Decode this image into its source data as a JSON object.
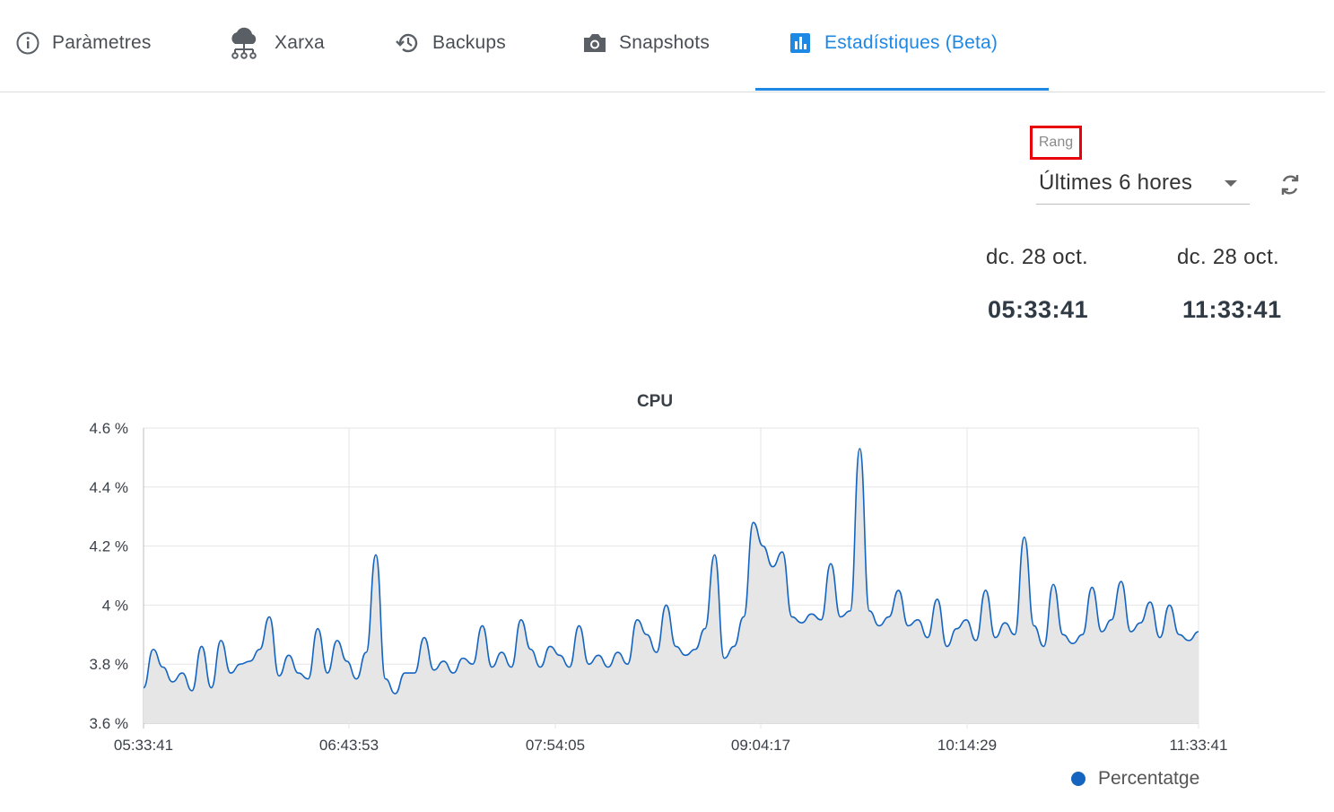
{
  "tabs": [
    {
      "label": "Paràmetres",
      "icon": "info-icon"
    },
    {
      "label": "Xarxa",
      "icon": "network-cloud-icon"
    },
    {
      "label": "Backups",
      "icon": "history-icon"
    },
    {
      "label": "Snapshots",
      "icon": "camera-icon"
    },
    {
      "label": "Estadístiques (Beta)",
      "icon": "bar-chart-icon",
      "active": true
    }
  ],
  "range": {
    "label": "Rang",
    "selected": "Últimes 6 hores",
    "refresh_icon": "refresh-icon"
  },
  "period": {
    "start_date": "dc. 28 oct.",
    "start_time": "05:33:41",
    "end_date": "dc. 28 oct.",
    "end_time": "11:33:41"
  },
  "colors": {
    "accent": "#1e88e5",
    "series": "#1565c0",
    "fill": "#e6e6e6",
    "highlight": "#e8000b"
  },
  "chart_data": {
    "type": "area",
    "title": "CPU",
    "xlabel": "",
    "ylabel": "",
    "x_ticks": [
      "05:33:41",
      "06:43:53",
      "07:54:05",
      "09:04:17",
      "10:14:29",
      "11:33:41"
    ],
    "y_ticks": [
      "3.6 %",
      "3.8 %",
      "4 %",
      "4.2 %",
      "4.4 %",
      "4.6 %"
    ],
    "ylim": [
      3.6,
      4.6
    ],
    "grid": true,
    "legend": "bottom-right",
    "series": [
      {
        "name": "Percentatge",
        "values": [
          3.72,
          3.85,
          3.79,
          3.74,
          3.77,
          3.71,
          3.86,
          3.72,
          3.88,
          3.77,
          3.8,
          3.81,
          3.85,
          3.96,
          3.76,
          3.83,
          3.77,
          3.75,
          3.92,
          3.77,
          3.88,
          3.81,
          3.75,
          3.84,
          4.17,
          3.75,
          3.7,
          3.77,
          3.77,
          3.89,
          3.78,
          3.81,
          3.77,
          3.82,
          3.8,
          3.93,
          3.79,
          3.84,
          3.79,
          3.95,
          3.85,
          3.79,
          3.86,
          3.83,
          3.79,
          3.93,
          3.8,
          3.83,
          3.79,
          3.84,
          3.8,
          3.95,
          3.9,
          3.84,
          4.0,
          3.86,
          3.83,
          3.85,
          3.92,
          4.17,
          3.82,
          3.86,
          3.96,
          4.28,
          4.2,
          4.13,
          4.18,
          3.96,
          3.94,
          3.97,
          3.95,
          4.14,
          3.96,
          3.98,
          4.53,
          3.98,
          3.93,
          3.96,
          4.05,
          3.93,
          3.95,
          3.89,
          4.02,
          3.86,
          3.92,
          3.95,
          3.88,
          4.05,
          3.89,
          3.94,
          3.9,
          4.23,
          3.93,
          3.86,
          4.07,
          3.9,
          3.87,
          3.9,
          4.06,
          3.91,
          3.95,
          4.08,
          3.91,
          3.94,
          4.01,
          3.89,
          4.0,
          3.9,
          3.88,
          3.91
        ]
      }
    ]
  }
}
